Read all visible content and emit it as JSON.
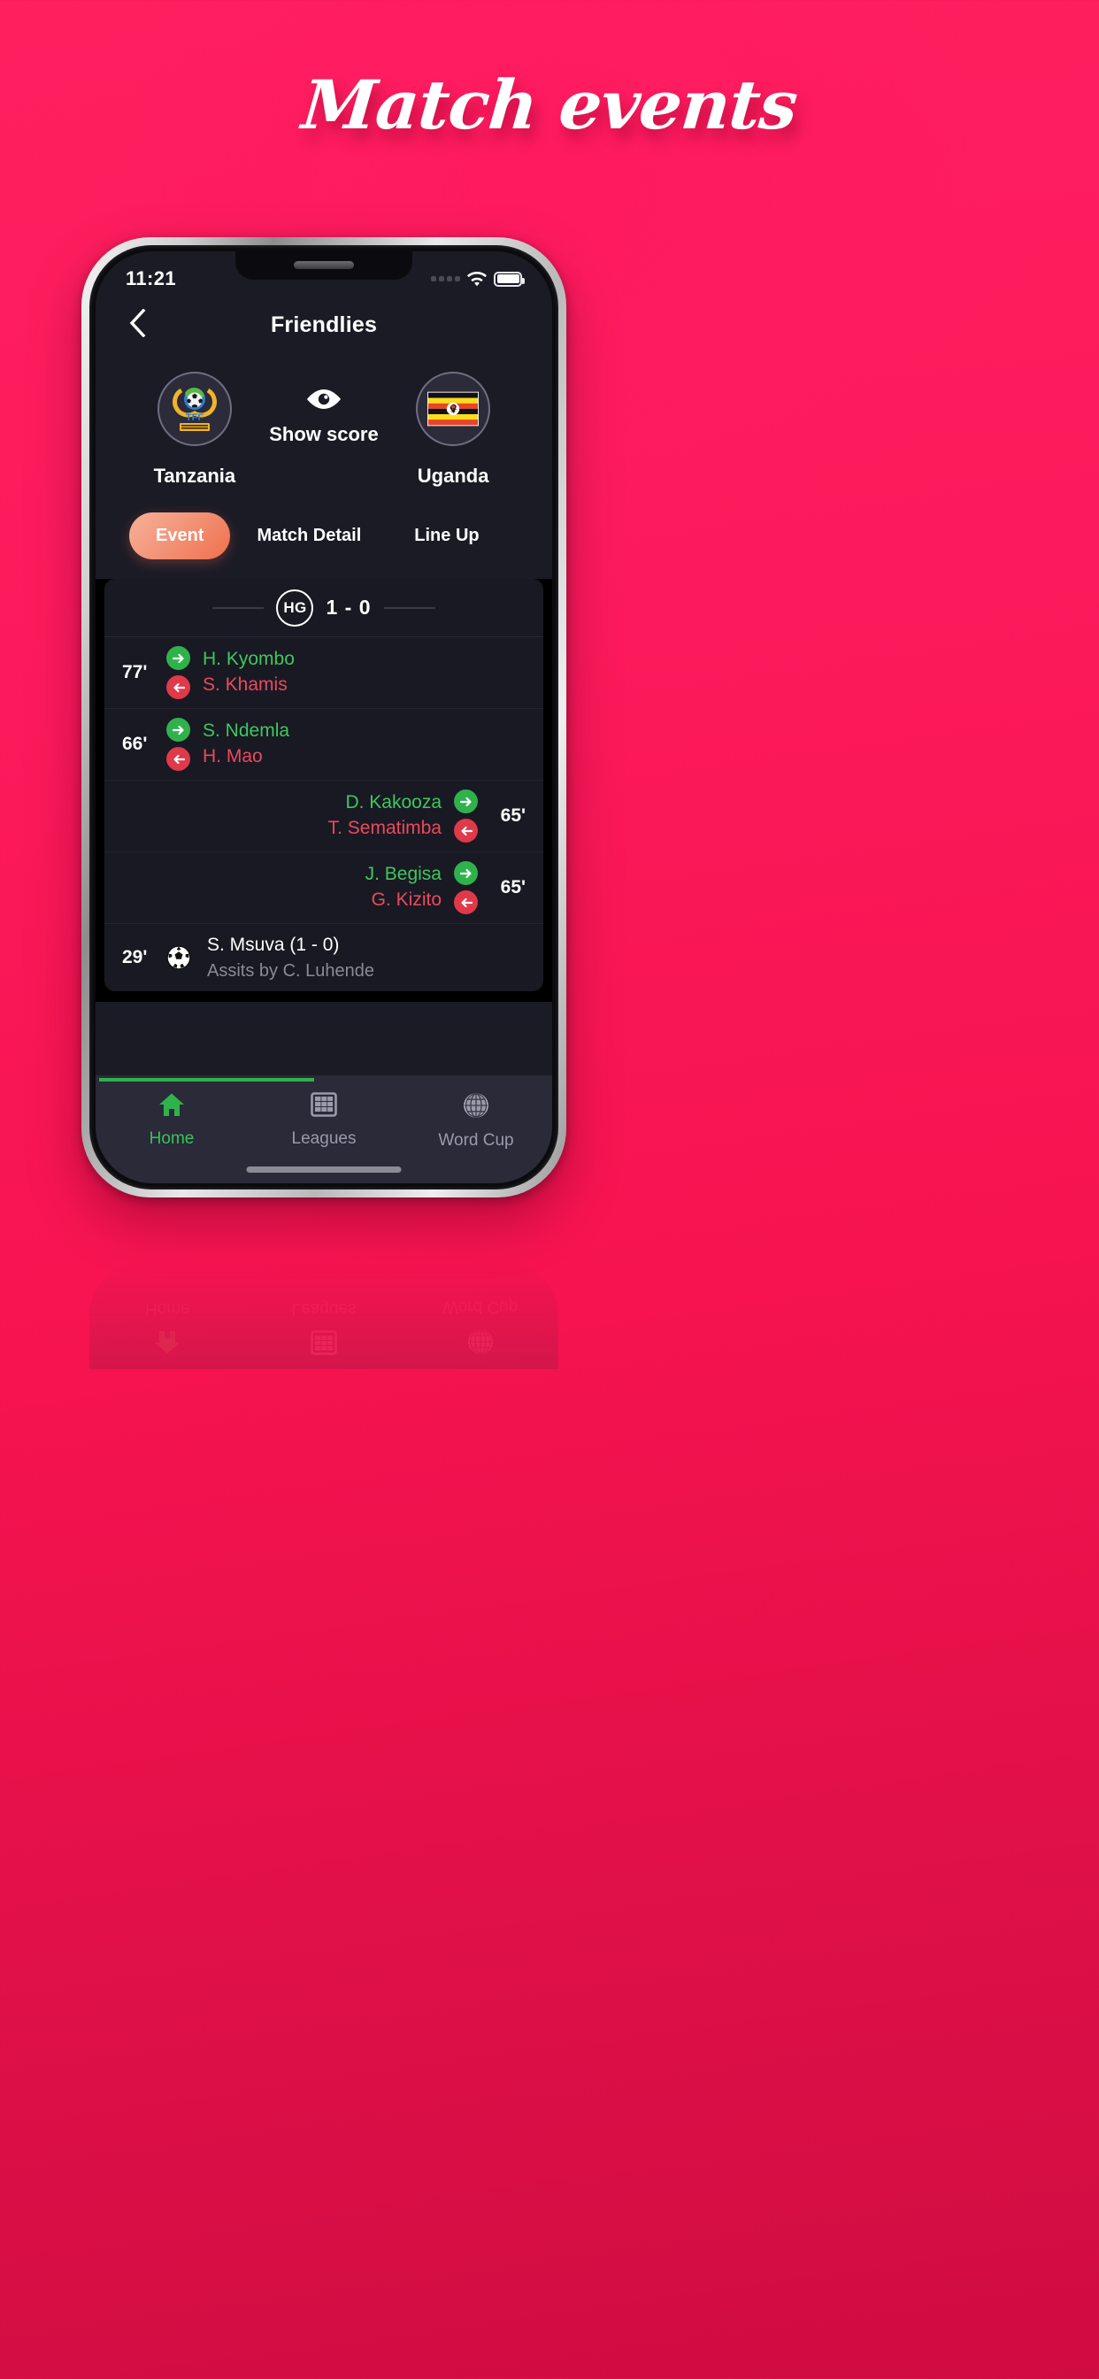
{
  "poster": {
    "title": "Match events"
  },
  "status_bar": {
    "time": "11:21",
    "signal_icon": "signal-dots-icon",
    "wifi_icon": "wifi-icon",
    "battery_icon": "battery-full-icon"
  },
  "header": {
    "back_icon": "chevron-left-icon",
    "title": "Friendlies"
  },
  "match": {
    "home_team": "Tanzania",
    "away_team": "Uganda",
    "home_crest_icon": "tanzania-tff-crest-icon",
    "away_crest_icon": "uganda-flag-icon",
    "show_score": {
      "label": "Show score",
      "icon": "eye-icon"
    }
  },
  "tabs": [
    {
      "label": "Event",
      "active": true
    },
    {
      "label": "Match Detail",
      "active": false
    },
    {
      "label": "Line Up",
      "active": false
    }
  ],
  "score_header": {
    "badge": "HG",
    "score": "1 - 0"
  },
  "events": [
    {
      "minute": "77'",
      "side": "left",
      "type": "substitution",
      "player_in": "H. Kyombo",
      "player_out": "S. Khamis",
      "in_icon": "arrow-right-circle-icon",
      "out_icon": "arrow-left-circle-icon"
    },
    {
      "minute": "66'",
      "side": "left",
      "type": "substitution",
      "player_in": "S. Ndemla",
      "player_out": "H. Mao",
      "in_icon": "arrow-right-circle-icon",
      "out_icon": "arrow-left-circle-icon"
    },
    {
      "minute": "65'",
      "side": "right",
      "type": "substitution",
      "player_in": "D. Kakooza",
      "player_out": "T. Sematimba",
      "in_icon": "arrow-right-circle-icon",
      "out_icon": "arrow-left-circle-icon"
    },
    {
      "minute": "65'",
      "side": "right",
      "type": "substitution",
      "player_in": "J. Begisa",
      "player_out": "G. Kizito",
      "in_icon": "arrow-right-circle-icon",
      "out_icon": "arrow-left-circle-icon"
    },
    {
      "minute": "29'",
      "side": "left",
      "type": "goal",
      "scorer": "S. Msuva (1 - 0)",
      "assist": "Assits by C. Luhende",
      "icon": "football-ball-icon"
    }
  ],
  "bottom_nav": [
    {
      "label": "Home",
      "icon": "home-icon",
      "active": true
    },
    {
      "label": "Leagues",
      "icon": "table-grid-icon",
      "active": false
    },
    {
      "label": "Word Cup",
      "icon": "globe-icon",
      "active": false
    }
  ],
  "colors": {
    "background_pink": "#fd1a5c",
    "screen_bg": "#1b1b26",
    "accent_orange": "#ef6f4d",
    "player_in_green": "#3fc75e",
    "player_out_red": "#ea4a5c",
    "nav_active_green": "#35c45a"
  }
}
